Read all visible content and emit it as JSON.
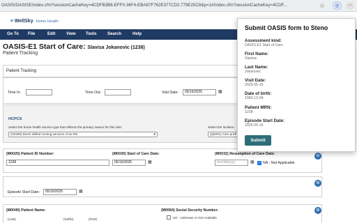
{
  "browser": {
    "url": "OASIS/OASISE/index.cfm?sessionCacheKey=4CDFB3B6-EFF0-36F4-EBA87F762E377CD2:779E25C8&p=1#/index.cfm?sessionCacheKey=4CDF..."
  },
  "app": {
    "logo_text": "WellSky",
    "logo_sub": "Home Health"
  },
  "nav": {
    "items": [
      "Go To",
      "File",
      "Edit",
      "View",
      "Tools",
      "Search",
      "Help"
    ]
  },
  "page": {
    "title": "OASIS-E1 Start of Care:",
    "patient_name": "Slavisa Jokanovic (1238)",
    "subtitle": "Patient Tracking"
  },
  "tracking": {
    "section_title": "Patient Tracking",
    "time_in_label": "Time In:",
    "time_in_value": "",
    "time_out_label": "Time Out:",
    "time_out_value": "",
    "visit_date_label": "Visit Date:",
    "visit_date_value": "05/16/2025"
  },
  "hcpcs": {
    "title": "HCPCS",
    "prompt": "Select the home health service type that reflects the primary reason for this visit:",
    "service_selected": "(G0299) Direct skilled nursing services of an RN",
    "location_prompt": "Select the location",
    "location_selected": "(Q5001) Care pro"
  },
  "m0020": {
    "label": "(M0020) Patient ID Number:",
    "value": "1238"
  },
  "m0030": {
    "label": "(M0030) Start of Care Date:",
    "value": "05/15/2025"
  },
  "m0032": {
    "label": "(M0032) Resumption of Care Date:",
    "placeholder": "mm/dd/yyyy",
    "na_label": "NA - Not Applicable",
    "na_checked": true
  },
  "episode": {
    "label": "Episode Start Date:",
    "value": "05/15/2025"
  },
  "m0040": {
    "label": "(M0040) Patient Name:",
    "last": "(Last)",
    "suffix": "(Suffix)",
    "first": "(First)"
  },
  "m0064": {
    "label": "(M0064) Social Security Number:",
    "uk_label": "UK - Unknown or Not Available"
  },
  "popup": {
    "title": "Submit OASIS form to Steno",
    "fields": [
      {
        "label": "Assessment kind:",
        "value": "OASIS-E1 Start of Care"
      },
      {
        "label": "First Name:",
        "value": "Slavisa"
      },
      {
        "label": "Last Name:",
        "value": "Jokanovic"
      },
      {
        "label": "Visit Date:",
        "value": "2025-05-16"
      },
      {
        "label": "Date of birth:",
        "value": "1965-12-04"
      },
      {
        "label": "Patient MRN:",
        "value": "1238"
      },
      {
        "label": "Episode Start Date:",
        "value": "2025-05-15"
      }
    ],
    "submit_label": "Submit"
  },
  "colors": {
    "nav_bg": "#1f3a63",
    "submit_bg": "#2d6d78",
    "checkbox_on": "#1a73e8"
  },
  "icons": [
    "star-icon",
    "extension-icon",
    "calendar-icon",
    "gear-icon",
    "wellsky-logo-icon"
  ]
}
